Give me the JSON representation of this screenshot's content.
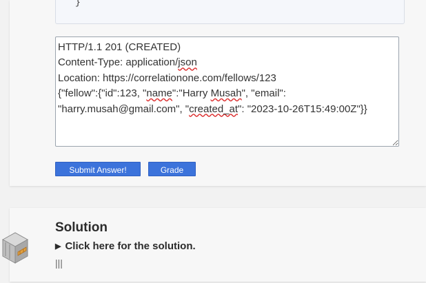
{
  "code_snippet": {
    "closing_brace": "}"
  },
  "answer": {
    "line1": "HTTP/1.1 201 (CREATED)",
    "line2_pre": "Content-Type: application/",
    "line2_spell": "json",
    "line3": "Location: https://correlationone.com/fellows/123",
    "line4_a": "{\"fellow\":{\"id\":123, \"",
    "line4_spell1": "name",
    "line4_b": "\":\"Harry ",
    "line4_spell2": "Musah",
    "line4_c": "\", \"email\": \"harry.musah@gmail.com\", \"",
    "line4_spell3": "created_at",
    "line4_d": "\": \"2023-10-26T15:49:00Z\"}}"
  },
  "buttons": {
    "submit": "Submit Answer!",
    "grade": "Grade"
  },
  "solution": {
    "title": "Solution",
    "toggle_marker": "▶",
    "toggle_label": "Click here for the solution.",
    "content_stub": "|||"
  },
  "icons": {
    "solution_decoration": "isometric-cube-icon"
  },
  "colors": {
    "button": "#3c73db",
    "spellcheck": "#d33"
  }
}
